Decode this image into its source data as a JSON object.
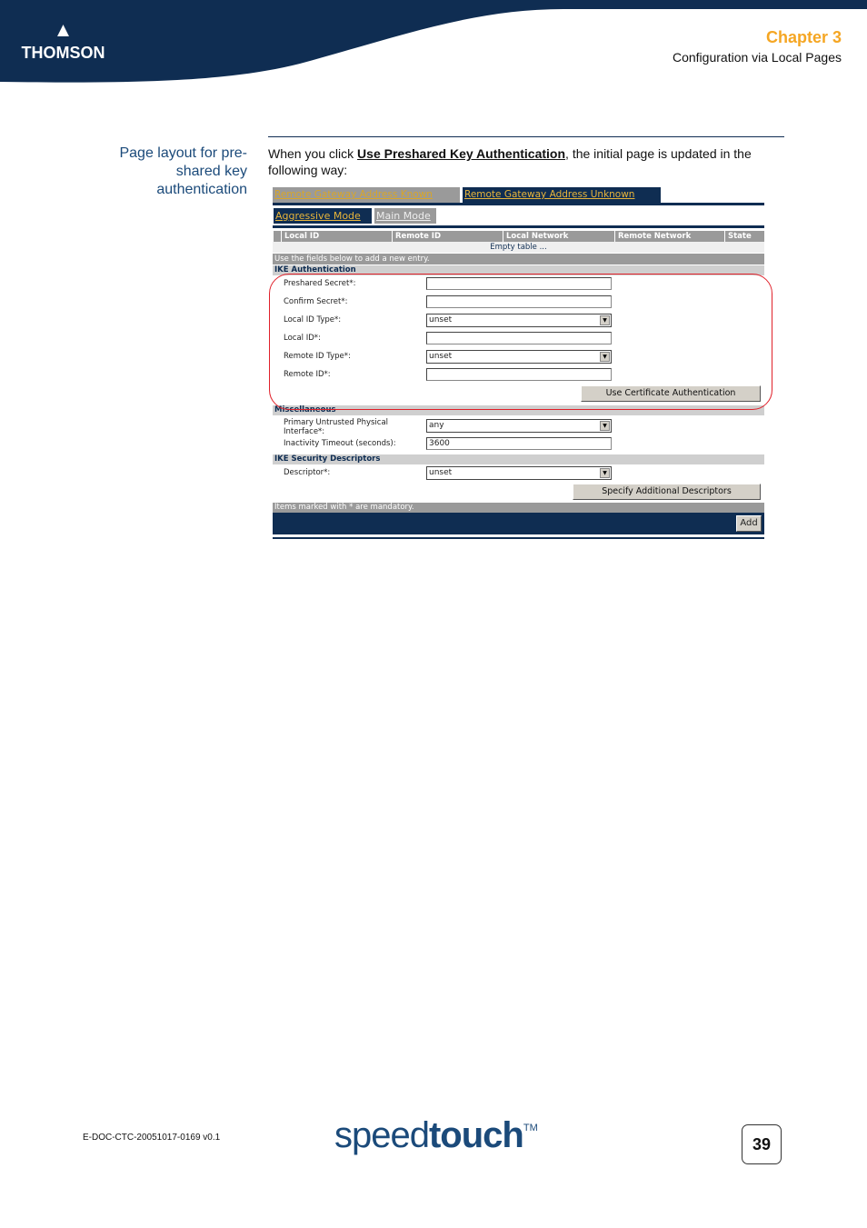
{
  "header": {
    "logo_text": "THOMSON",
    "chapter": "Chapter 3",
    "chapter_subtitle": "Configuration via Local Pages",
    "colors": {
      "navy": "#0f2d52",
      "chapter_orange": "#f5a623"
    }
  },
  "section": {
    "side_title": "Page layout for pre-shared key authentication",
    "intro_before": "When you click ",
    "intro_link": "Use Preshared Key Authentication",
    "intro_after": ", the initial page is updated in the following way:"
  },
  "screenshot": {
    "tabs_gateway": [
      "Remote Gateway Address Known",
      "Remote Gateway Address Unknown"
    ],
    "tabs_mode": [
      "Aggressive Mode",
      "Main Mode"
    ],
    "table_columns": [
      "Local ID",
      "Remote ID",
      "Local Network",
      "Remote Network",
      "State"
    ],
    "empty_table": "Empty table ...",
    "hint": "Use the fields below to add a new entry.",
    "ike_auth": {
      "title": "IKE Authentication",
      "preshared_secret_label": "Preshared Secret*:",
      "preshared_secret_value": "",
      "confirm_secret_label": "Confirm Secret*:",
      "confirm_secret_value": "",
      "local_id_type_label": "Local ID Type*:",
      "local_id_type_value": "unset",
      "local_id_label": "Local ID*:",
      "local_id_value": "",
      "remote_id_type_label": "Remote ID Type*:",
      "remote_id_type_value": "unset",
      "remote_id_label": "Remote ID*:",
      "remote_id_value": "",
      "cert_button": "Use Certificate Authentication"
    },
    "misc": {
      "title": "Miscellaneous",
      "interface_label": "Primary Untrusted Physical Interface*:",
      "interface_value": "any",
      "timeout_label": "Inactivity Timeout (seconds):",
      "timeout_value": "3600"
    },
    "descriptors": {
      "title": "IKE Security Descriptors",
      "descriptor_label": "Descriptor*:",
      "descriptor_value": "unset",
      "additional_button": "Specify Additional Descriptors"
    },
    "mandatory_note": "Items marked with * are mandatory.",
    "add_button": "Add"
  },
  "footer": {
    "doc_id": "E-DOC-CTC-20051017-0169 v0.1",
    "brand_light": "speed",
    "brand_bold": "touch",
    "brand_tm": "TM",
    "page_number": "39"
  }
}
